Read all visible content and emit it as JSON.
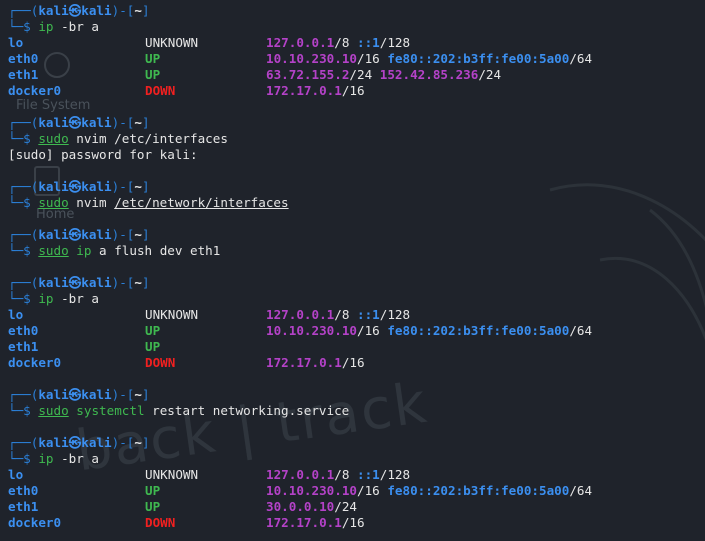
{
  "background": {
    "watermark": "back | track",
    "desktop_icon_1": "File System",
    "desktop_icon_2": "Home"
  },
  "prompt": {
    "corner_top": "┌──(",
    "user": "kali㉿kali",
    "mid": ")-[",
    "dir": "~",
    "end": "]",
    "corner_bottom": "└─$ "
  },
  "blocks": [
    {
      "command": {
        "cmd": "ip",
        "args": " -br a"
      },
      "output": [
        {
          "iface": "lo",
          "state": "UNKNOWN",
          "addrs": [
            {
              "ip": "127.0.0.1",
              "mask": "/8",
              "type": "v4"
            },
            {
              "ip": "::1",
              "mask": "/128",
              "type": "v6"
            }
          ]
        },
        {
          "iface": "eth0",
          "state": "UP",
          "addrs": [
            {
              "ip": "10.10.230.10",
              "mask": "/16",
              "type": "v4"
            },
            {
              "ip": "fe80::202:b3ff:fe00:5a00",
              "mask": "/64",
              "type": "v6"
            }
          ]
        },
        {
          "iface": "eth1",
          "state": "UP",
          "addrs": [
            {
              "ip": "63.72.155.2",
              "mask": "/24",
              "type": "v4"
            },
            {
              "ip": "152.42.85.236",
              "mask": "/24",
              "type": "v4"
            }
          ]
        },
        {
          "iface": "docker0",
          "state": "DOWN",
          "addrs": [
            {
              "ip": "172.17.0.1",
              "mask": "/16",
              "type": "v4"
            }
          ]
        }
      ]
    },
    {
      "command": {
        "cmd": "sudo",
        "args": " nvim /etc/interfaces"
      },
      "text_output": [
        "[sudo] password for kali:"
      ]
    },
    {
      "command": {
        "cmd": "sudo",
        "args": " nvim ",
        "underlined_arg": "/etc/network/interfaces"
      }
    },
    {
      "command": {
        "cmd": "sudo",
        "args": " ip a flush dev eth1",
        "cmd2": "ip"
      }
    },
    {
      "command": {
        "cmd": "ip",
        "args": " -br a"
      },
      "output": [
        {
          "iface": "lo",
          "state": "UNKNOWN",
          "addrs": [
            {
              "ip": "127.0.0.1",
              "mask": "/8",
              "type": "v4"
            },
            {
              "ip": "::1",
              "mask": "/128",
              "type": "v6"
            }
          ]
        },
        {
          "iface": "eth0",
          "state": "UP",
          "addrs": [
            {
              "ip": "10.10.230.10",
              "mask": "/16",
              "type": "v4"
            },
            {
              "ip": "fe80::202:b3ff:fe00:5a00",
              "mask": "/64",
              "type": "v6"
            }
          ]
        },
        {
          "iface": "eth1",
          "state": "UP",
          "addrs": []
        },
        {
          "iface": "docker0",
          "state": "DOWN",
          "addrs": [
            {
              "ip": "172.17.0.1",
              "mask": "/16",
              "type": "v4"
            }
          ]
        }
      ]
    },
    {
      "command": {
        "cmd": "sudo",
        "args": " restart networking.service",
        "cmd2": "systemctl"
      }
    },
    {
      "command": {
        "cmd": "ip",
        "args": " -br a"
      },
      "output": [
        {
          "iface": "lo",
          "state": "UNKNOWN",
          "addrs": [
            {
              "ip": "127.0.0.1",
              "mask": "/8",
              "type": "v4"
            },
            {
              "ip": "::1",
              "mask": "/128",
              "type": "v6"
            }
          ]
        },
        {
          "iface": "eth0",
          "state": "UP",
          "addrs": [
            {
              "ip": "10.10.230.10",
              "mask": "/16",
              "type": "v4"
            },
            {
              "ip": "fe80::202:b3ff:fe00:5a00",
              "mask": "/64",
              "type": "v6"
            }
          ]
        },
        {
          "iface": "eth1",
          "state": "UP",
          "addrs": [
            {
              "ip": "30.0.0.10",
              "mask": "/24",
              "type": "v4"
            }
          ]
        },
        {
          "iface": "docker0",
          "state": "DOWN",
          "addrs": [
            {
              "ip": "172.17.0.1",
              "mask": "/16",
              "type": "v4"
            }
          ]
        }
      ]
    }
  ]
}
